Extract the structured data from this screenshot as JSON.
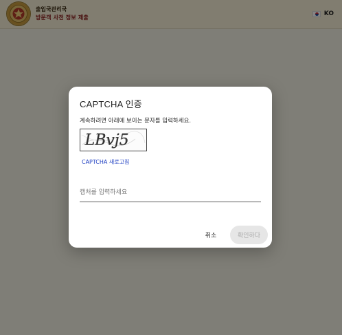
{
  "header": {
    "org_name": "출입국관리국",
    "org_subtitle": "방문객 사전 정보 제출",
    "language": "KO",
    "flag_icon": "korea-flag-icon",
    "logo_icon": "emblem-seal-icon"
  },
  "dialog": {
    "title": "CAPTCHA 인증",
    "description": "계속하려면 아래에 보이는 문자를 입력하세요.",
    "captcha_text": "LBvj5",
    "refresh_label": "CAPTCHA 새로고침",
    "input_placeholder": "캡처를 입력하세요",
    "input_value": "",
    "cancel_label": "취소",
    "confirm_label": "확인하다",
    "confirm_disabled": true
  },
  "colors": {
    "overlay": "#7a7a7a",
    "link": "#1e3ec2",
    "header_bg": "#f7f0d6",
    "subtitle": "#8a1c1c"
  }
}
